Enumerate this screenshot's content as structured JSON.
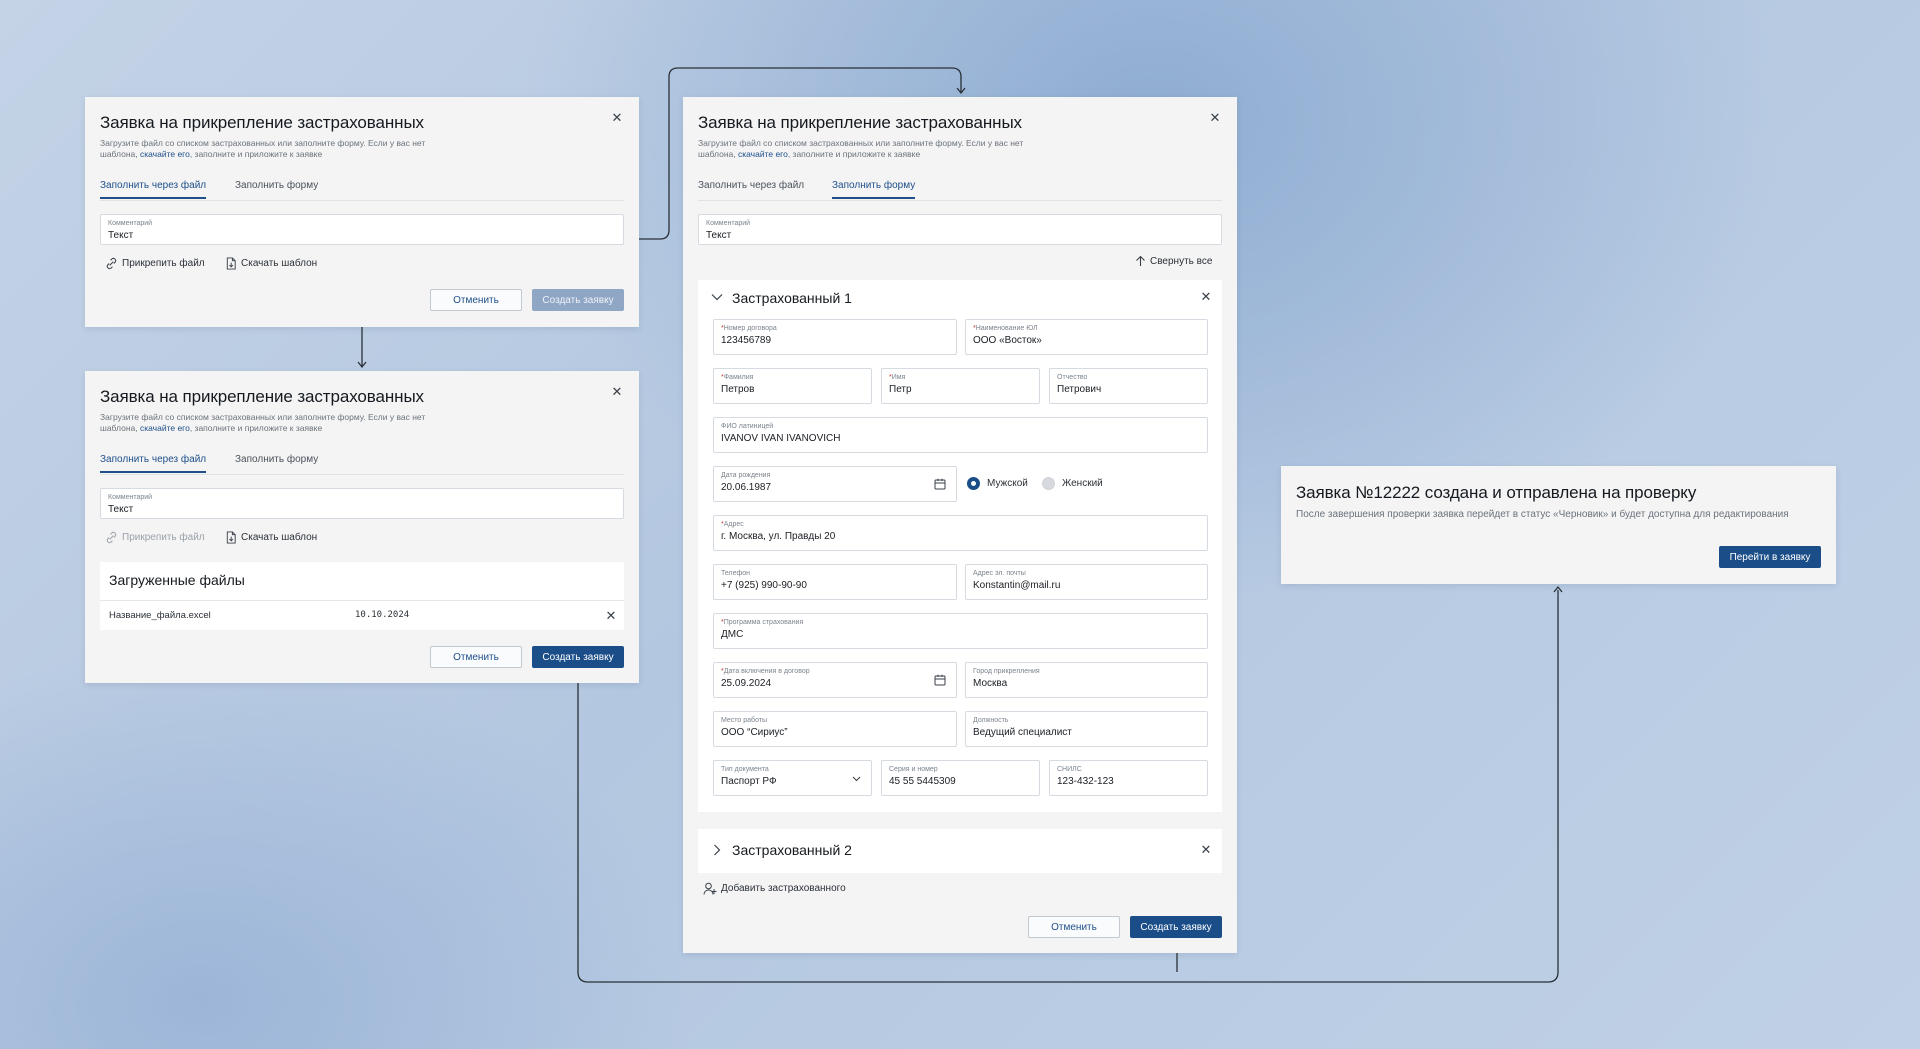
{
  "dialog": {
    "title": "Заявка на прикрепление застрахованных",
    "subtitle_before": "Загрузите файл со списком застрахованных или заполните форму. Если у вас нет шаблона, ",
    "subtitle_link": "скачайте его",
    "subtitle_after": ", заполните и приложите к заявке",
    "tabs": [
      "Заполнить через файл",
      "Заполнить форму"
    ],
    "comment_label": "Комментарий",
    "comment_value": "Текст",
    "attach_label": "Прикрепить файл",
    "download_label": "Скачать шаблон",
    "cancel_label": "Отменить",
    "create_label": "Создать заявку"
  },
  "uploaded": {
    "title": "Загруженные файлы",
    "file_name": "Название_файла.excel",
    "file_date": "10.10.2024"
  },
  "form": {
    "collapse_all": "Свернуть все",
    "insured1_title": "Застрахованный 1",
    "insured2_title": "Застрахованный 2",
    "add_insured": "Добавить застрахованного",
    "fields": {
      "contract_no": {
        "label": "Номер договора",
        "value": "123456789",
        "required": true
      },
      "org_name": {
        "label": "Наименование ЮЛ",
        "value": "ООО «Восток»",
        "required": true
      },
      "last_name": {
        "label": "Фамилия",
        "value": "Петров",
        "required": true
      },
      "first_name": {
        "label": "Имя",
        "value": "Петр",
        "required": true
      },
      "patronymic": {
        "label": "Отчество",
        "value": "Петрович",
        "required": false
      },
      "latin_name": {
        "label": "ФИО латиницей",
        "value": "IVANOV IVAN IVANOVICH",
        "required": false
      },
      "birth_date": {
        "label": "Дата рождения",
        "value": "20.06.1987",
        "required": false
      },
      "address": {
        "label": "Адрес",
        "value": "г. Москва, ул. Правды 20",
        "required": true
      },
      "phone": {
        "label": "Телефон",
        "value": "+7 (925) 990-90-90",
        "required": false
      },
      "email": {
        "label": "Адрес эл. почты",
        "value": "Konstantin@mail.ru",
        "required": false
      },
      "program": {
        "label": "Программа страхования",
        "value": "ДМС",
        "required": true
      },
      "inclusion_date": {
        "label": "Дата включения в договор",
        "value": "25.09.2024",
        "required": true
      },
      "city": {
        "label": "Город прикрепления",
        "value": "Москва",
        "required": false
      },
      "workplace": {
        "label": "Место работы",
        "value": "ООО “Сириус”",
        "required": false
      },
      "position": {
        "label": "Должность",
        "value": "Ведущий специалист",
        "required": false
      },
      "doc_type": {
        "label": "Тип документа",
        "value": "Паспорт РФ",
        "required": false
      },
      "doc_number": {
        "label": "Серия и номер",
        "value": "45 55 5445309",
        "required": false
      },
      "snils": {
        "label": "СНИЛС",
        "value": "123-432-123",
        "required": false
      }
    },
    "gender": {
      "male": "Мужской",
      "female": "Женский",
      "selected": "male"
    }
  },
  "success": {
    "title": "Заявка №12222 создана и отправлена на проверку",
    "text": "После завершения проверки заявка перейдет в статус «Черновик» и будет доступна для редактирования",
    "button": "Перейти в заявку"
  },
  "colors": {
    "accent": "#1b4e89",
    "disabled": "#8fa6c5",
    "required": "#c0392b"
  }
}
